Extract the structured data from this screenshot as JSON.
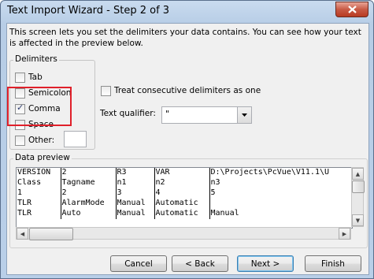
{
  "window": {
    "title": "Text Import Wizard - Step 2 of 3",
    "close_glyph": "✕"
  },
  "intro_text": "This screen lets you set the delimiters your data contains.  You can see how your text is affected in the preview below.",
  "delimiters": {
    "title": "Delimiters",
    "items": [
      {
        "label": "Tab",
        "checked": false
      },
      {
        "label": "Semicolon",
        "checked": false
      },
      {
        "label": "Comma",
        "checked": true
      },
      {
        "label": "Space",
        "checked": false
      },
      {
        "label": "Other:",
        "checked": false
      }
    ],
    "other_value": ""
  },
  "consecutive": {
    "label": "Treat consecutive delimiters as one",
    "checked": false
  },
  "text_qualifier": {
    "label": "Text qualifier:",
    "value": "\""
  },
  "preview": {
    "title": "Data preview",
    "rows": [
      [
        "VERSION",
        "2",
        "R3",
        "VAR",
        "D:\\Projects\\PcVue\\V11.1\\U"
      ],
      [
        "Class",
        "Tagname",
        "n1",
        "n2",
        "n3"
      ],
      [
        "1",
        "2",
        "3",
        "4",
        "5"
      ],
      [
        "TLR",
        "AlarmMode",
        "Manual",
        "Automatic",
        ""
      ],
      [
        "TLR",
        "Auto",
        "Manual",
        "Automatic",
        "Manual"
      ]
    ]
  },
  "buttons": {
    "cancel": "Cancel",
    "back": "< Back",
    "next": "Next >",
    "finish": "Finish"
  }
}
